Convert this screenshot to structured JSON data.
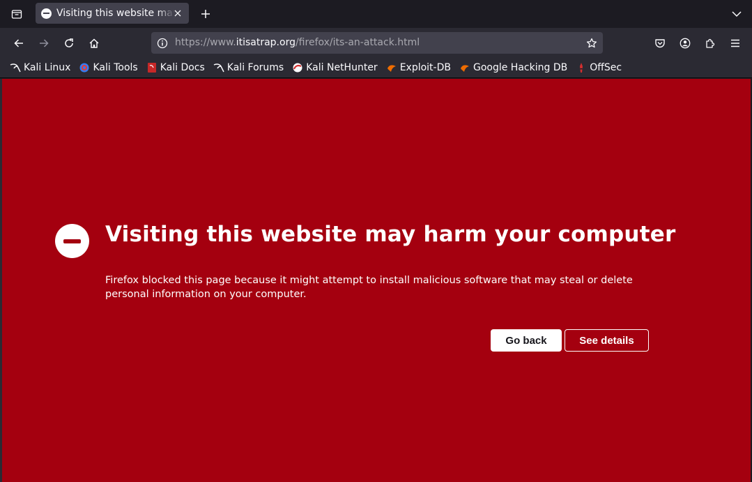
{
  "tab": {
    "title": "Visiting this website may harm your computer",
    "favicon": "blocked-icon"
  },
  "navbar": {
    "url_prefix": "https://www.",
    "url_domain": "itisatrap.org",
    "url_path": "/firefox/its-an-attack.html"
  },
  "bookmarks": [
    {
      "label": "Kali Linux",
      "icon": "kali-dragon-icon"
    },
    {
      "label": "Kali Tools",
      "icon": "kali-tools-icon"
    },
    {
      "label": "Kali Docs",
      "icon": "kali-docs-icon"
    },
    {
      "label": "Kali Forums",
      "icon": "kali-dragon-icon"
    },
    {
      "label": "Kali NetHunter",
      "icon": "nethunter-icon"
    },
    {
      "label": "Exploit-DB",
      "icon": "exploit-db-icon"
    },
    {
      "label": "Google Hacking DB",
      "icon": "ghdb-icon"
    },
    {
      "label": "OffSec",
      "icon": "offsec-icon"
    }
  ],
  "page": {
    "title": "Visiting this website may harm your computer",
    "description": "Firefox blocked this page because it might attempt to install malicious software that may steal or delete personal information on your computer.",
    "go_back_label": "Go back",
    "see_details_label": "See details"
  },
  "colors": {
    "page_background": "#a4000f",
    "chrome_dark": "#1c1b22",
    "toolbar": "#2b2a33",
    "urlbar": "#42414d"
  }
}
